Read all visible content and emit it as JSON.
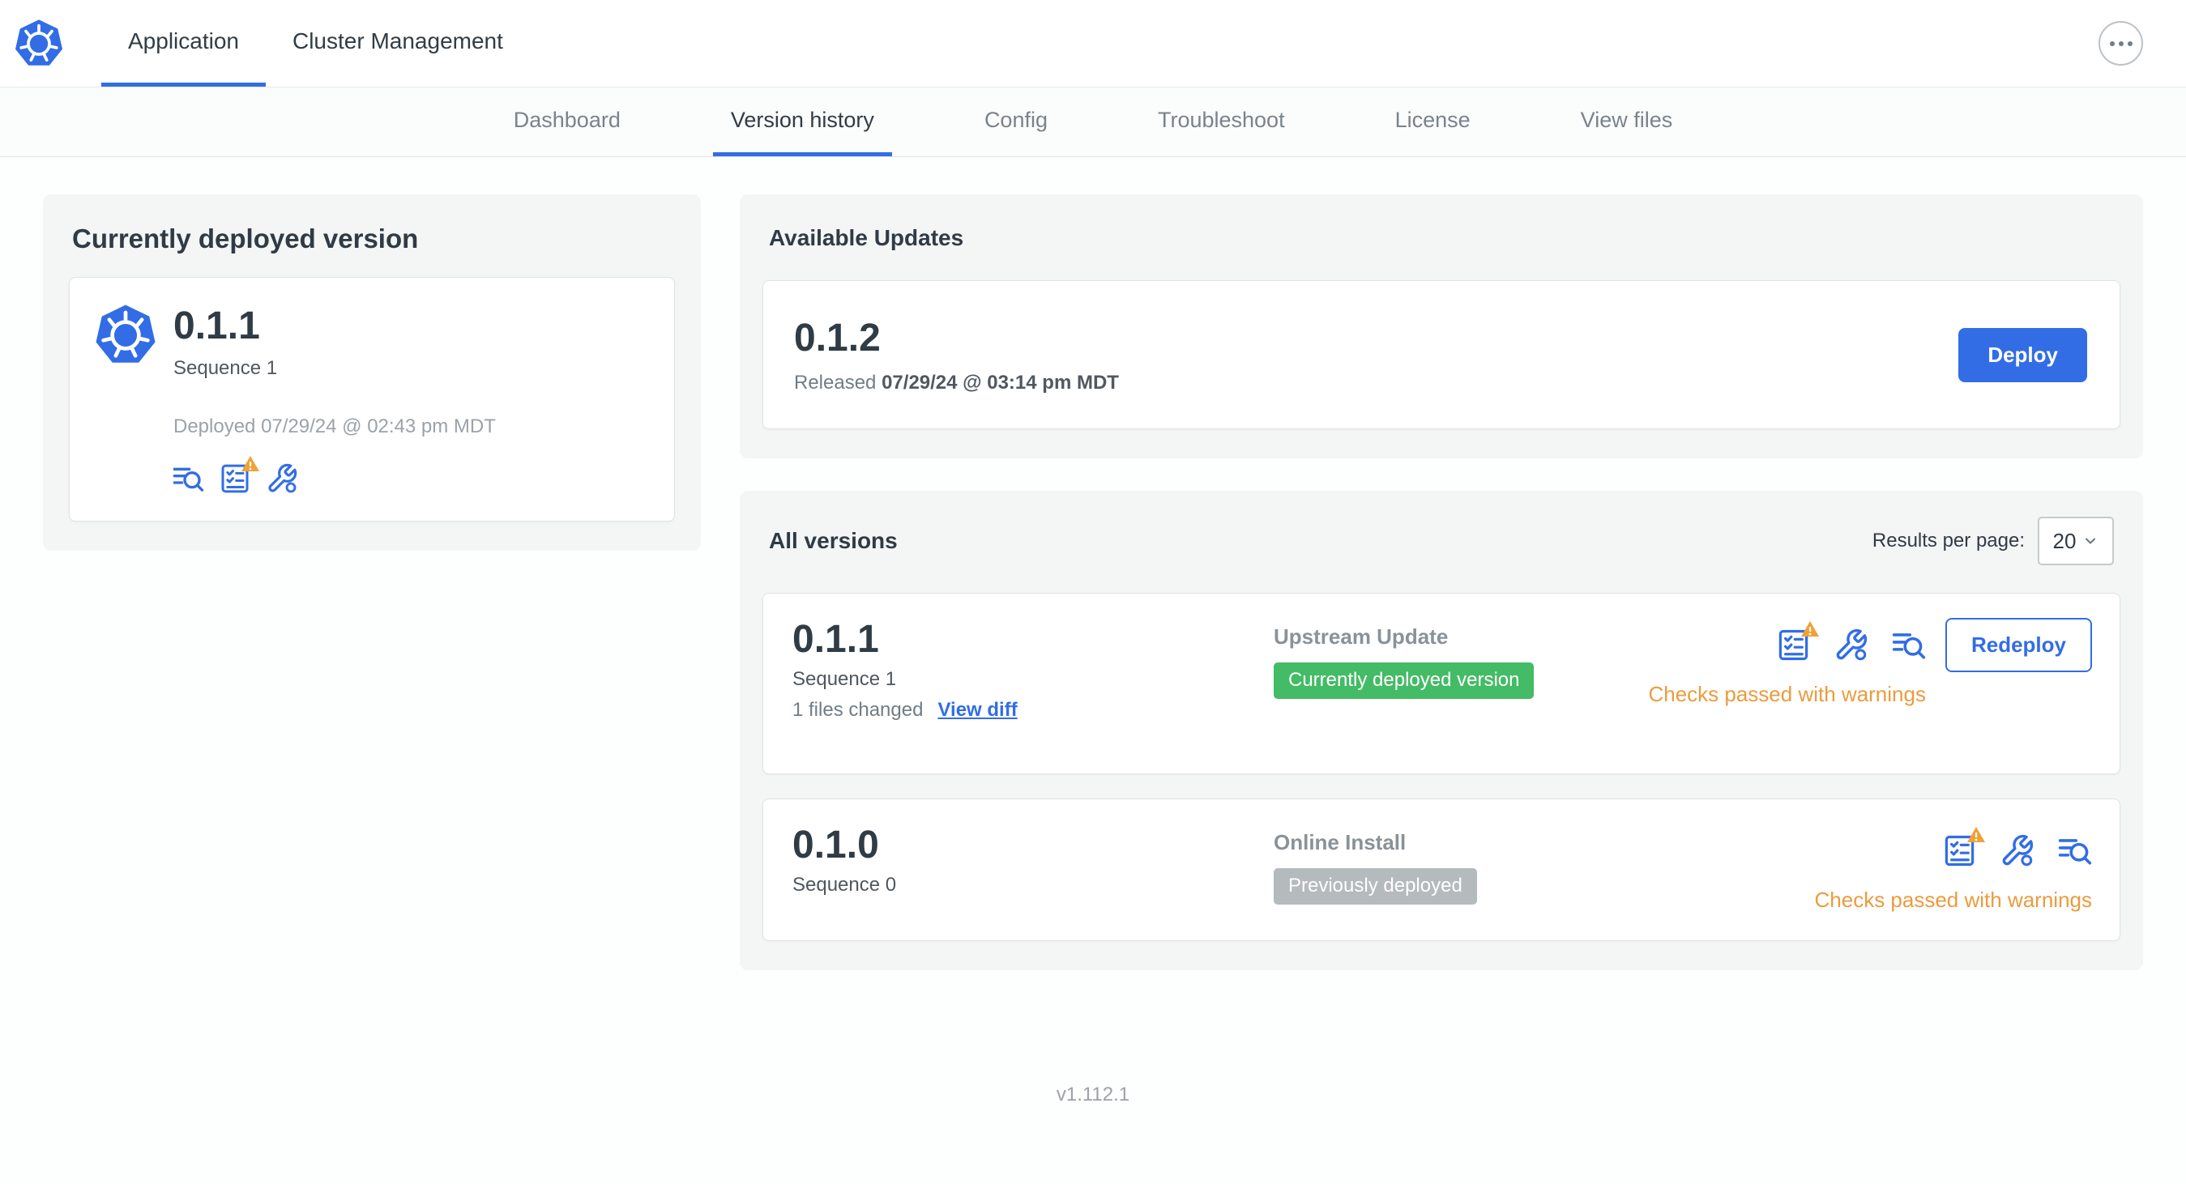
{
  "colors": {
    "primary_blue": "#326de6",
    "green_badge": "#44bb66",
    "gray_badge": "#b5babd",
    "warning_orange": "#ec9b3e",
    "warning_triangle": "#efa236"
  },
  "topnav": {
    "tabs": [
      {
        "label": "Application"
      },
      {
        "label": "Cluster Management"
      }
    ]
  },
  "subnav": {
    "tabs": [
      {
        "label": "Dashboard"
      },
      {
        "label": "Version history"
      },
      {
        "label": "Config"
      },
      {
        "label": "Troubleshoot"
      },
      {
        "label": "License"
      },
      {
        "label": "View files"
      }
    ]
  },
  "current_version": {
    "title": "Currently deployed version",
    "version": "0.1.1",
    "sequence": "Sequence 1",
    "deployed": "Deployed 07/29/24 @ 02:43 pm MDT"
  },
  "available_updates": {
    "title": "Available Updates",
    "version": "0.1.2",
    "released_label": "Released",
    "released_date": "07/29/24 @ 03:14 pm MDT",
    "deploy_button": "Deploy"
  },
  "all_versions": {
    "title": "All versions",
    "results_per_page_label": "Results per page:",
    "results_per_page_value": "20",
    "rows": [
      {
        "version": "0.1.1",
        "sequence": "Sequence 1",
        "files_changed": "1 files changed",
        "view_diff_label": "View diff",
        "source": "Upstream Update",
        "badge": "Currently deployed version",
        "status": "Checks passed with warnings",
        "action_button": "Redeploy"
      },
      {
        "version": "0.1.0",
        "sequence": "Sequence 0",
        "source": "Online Install",
        "badge": "Previously deployed",
        "status": "Checks passed with warnings"
      }
    ]
  },
  "footer": {
    "app_version": "v1.112.1"
  }
}
